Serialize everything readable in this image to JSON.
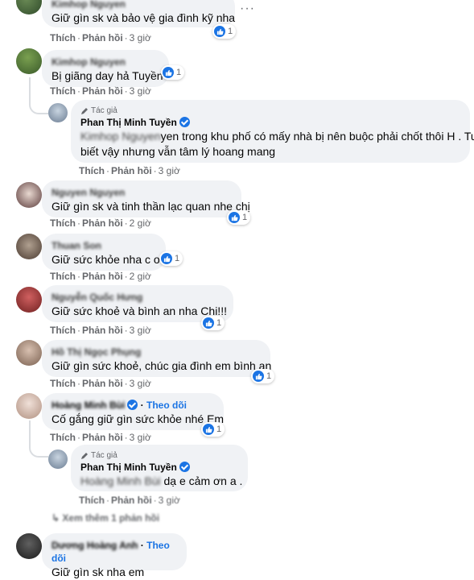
{
  "comments": [
    {
      "name": "Kimhop Nguyen",
      "text": "Giữ gìn sk và bảo vệ gia đình kỹ nha",
      "like_label": "Thích",
      "reply_label": "Phản hồi",
      "time": "3 giờ",
      "reactions": "1"
    },
    {
      "name": "Kimhop Nguyen",
      "text": "Bị giãng day hả Tuyền",
      "like_label": "Thích",
      "reply_label": "Phản hồi",
      "time": "3 giờ",
      "reactions": "1"
    },
    {
      "author_badge": "Tác giả",
      "name": "Phan Thị Minh Tuyền",
      "mention": "Kimhop Nguyen",
      "text_line1": "yen trong khu phố có mấy nhà bị nên buộc phải chốt thôi H . Tuy",
      "text_line2": "biết vậy nhưng vẫn tâm lý hoang mang",
      "like_label": "Thích",
      "reply_label": "Phản hồi",
      "time": "3 giờ"
    },
    {
      "name": "Nguyen Nguyen",
      "text": "Giữ gìn sk và tinh thần lạc quan nhe chị",
      "like_label": "Thích",
      "reply_label": "Phản hồi",
      "time": "2 giờ",
      "reactions": "1"
    },
    {
      "name": "Thuan Son",
      "text": "Giữ sức khỏe nha c ơi",
      "like_label": "Thích",
      "reply_label": "Phản hồi",
      "time": "2 giờ",
      "reactions": "1"
    },
    {
      "name": "Nguyễn Quốc Hưng",
      "text": "Giữ sức khoẻ và bình an nha Chị!!!",
      "like_label": "Thích",
      "reply_label": "Phản hồi",
      "time": "3 giờ",
      "reactions": "1"
    },
    {
      "name": "Hồ Thị Ngọc Phụng",
      "text": "Giữ gìn sức khoẻ, chúc gia đình em bình an",
      "like_label": "Thích",
      "reply_label": "Phản hồi",
      "time": "3 giờ",
      "reactions": "1"
    },
    {
      "name": "Hoàng Minh Bùi",
      "follow": "Theo dõi",
      "text": "Cố gắng giữ gìn sức khỏe nhé Em",
      "like_label": "Thích",
      "reply_label": "Phản hồi",
      "time": "3 giờ",
      "reactions": "1"
    },
    {
      "author_badge": "Tác giả",
      "name": "Phan Thị Minh Tuyền",
      "mention": "Hoàng Minh Bùi",
      "text": "dạ e cảm ơn a .",
      "like_label": "Thích",
      "reply_label": "Phản hồi",
      "time": "3 giờ"
    },
    {
      "name": "Dương Hoàng Anh",
      "follow": "Theo dõi",
      "text": "Giữ gìn sk nha em"
    }
  ],
  "view_more_replies": "Xem thêm 1 phản hồi",
  "more_options": "···",
  "colors": {
    "like_blue": "#1b74e4",
    "bubble_bg": "#f0f2f5",
    "meta_gray": "#65676b"
  }
}
